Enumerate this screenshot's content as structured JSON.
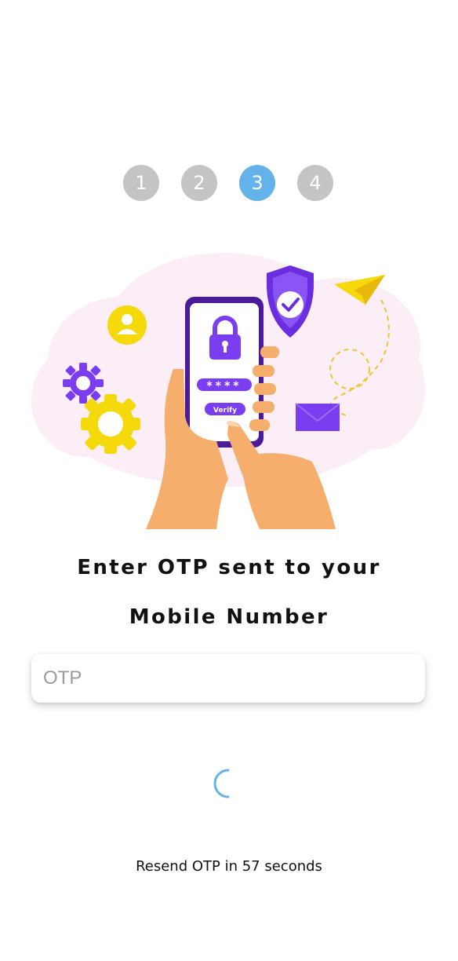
{
  "stepper": {
    "steps": [
      "1",
      "2",
      "3",
      "4"
    ],
    "active_step": 3,
    "active_color": "#64b2ea",
    "inactive_color": "#c4c4c4"
  },
  "illustration": {
    "icons": [
      "user-icon",
      "gear-icon",
      "phone-icon",
      "lock-icon",
      "shield-check-icon",
      "paper-plane-icon",
      "envelope-icon",
      "hand-icon"
    ],
    "password_mask": "****",
    "verify_label": "Verify"
  },
  "heading": {
    "line1": "Enter OTP sent to your",
    "line2": "Mobile Number"
  },
  "otp_field": {
    "value": "",
    "placeholder": "OTP"
  },
  "loading": {
    "spinner_color": "#64b2ea"
  },
  "resend": {
    "text": "Resend OTP in 57 seconds"
  }
}
